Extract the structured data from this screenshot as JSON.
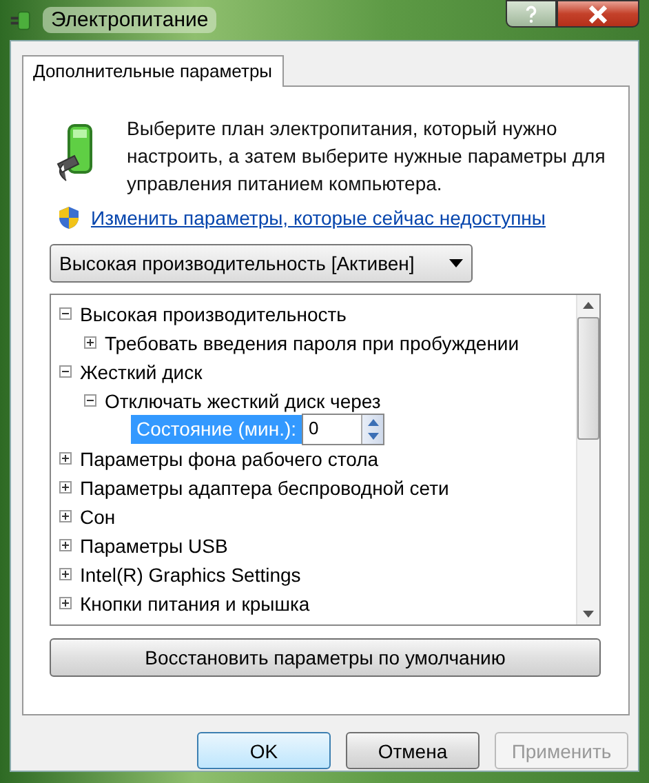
{
  "window": {
    "title": "Электропитание"
  },
  "tabs": [
    {
      "label": "Дополнительные параметры",
      "selected": true
    }
  ],
  "intro": "Выберите план электропитания, который нужно настроить, а затем выберите нужные параметры для управления питанием компьютера.",
  "link": "Изменить параметры, которые сейчас недоступны",
  "plan_select": {
    "value": "Высокая производительность [Активен]"
  },
  "tree": [
    {
      "label": "Высокая производительность",
      "expanded": true,
      "children": [
        {
          "label": "Требовать введения пароля при пробуждении",
          "expanded": false
        }
      ]
    },
    {
      "label": "Жесткий диск",
      "expanded": true,
      "children": [
        {
          "label": "Отключать жесткий диск через",
          "expanded": true,
          "children": [
            {
              "kind": "setting",
              "label": "Состояние (мин.):",
              "value": "0",
              "selected": true
            }
          ]
        }
      ]
    },
    {
      "label": "Параметры фона рабочего стола",
      "expanded": false
    },
    {
      "label": "Параметры адаптера беспроводной сети",
      "expanded": false
    },
    {
      "label": "Сон",
      "expanded": false
    },
    {
      "label": "Параметры USB",
      "expanded": false
    },
    {
      "label": "Intel(R) Graphics Settings",
      "expanded": false
    },
    {
      "label": "Кнопки питания и крышка",
      "expanded": false
    }
  ],
  "restore_button": "Восстановить параметры по умолчанию",
  "buttons": [
    {
      "label": "OK",
      "kind": "default",
      "disabled": false
    },
    {
      "label": "Отмена",
      "kind": "normal",
      "disabled": false
    },
    {
      "label": "Применить",
      "kind": "normal",
      "disabled": true
    }
  ]
}
